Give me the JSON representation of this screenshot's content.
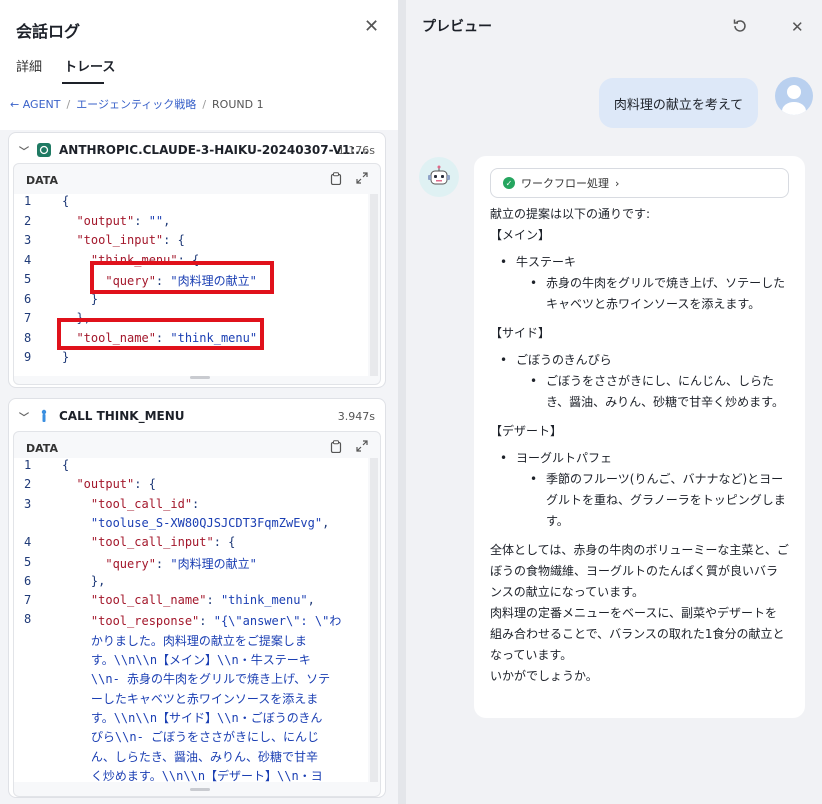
{
  "left_panel": {
    "title": "会話ログ",
    "close_icon": "close-icon",
    "tabs": [
      "詳細",
      "トレース"
    ],
    "active_tab": "トレース",
    "breadcrumb": [
      "← AGENT",
      "エージェンティック戦略",
      "ROUND 1"
    ],
    "card1": {
      "title": "ANTHROPIC.CLAUDE-3-HAIKU-20240307-V1:...",
      "duration": "1.176s",
      "data_label": "DATA",
      "icon": "model-icon",
      "lines": [
        {
          "n": "1",
          "parts": [
            {
              "t": "p",
              "v": "{"
            }
          ]
        },
        {
          "n": "2",
          "parts": [
            {
              "t": "k",
              "v": "  \"output\""
            },
            {
              "t": "p",
              "v": ": "
            },
            {
              "t": "s",
              "v": "\"\""
            },
            {
              "t": "p",
              "v": ","
            }
          ]
        },
        {
          "n": "3",
          "parts": [
            {
              "t": "k",
              "v": "  \"tool_input\""
            },
            {
              "t": "p",
              "v": ": {"
            }
          ]
        },
        {
          "n": "4",
          "parts": [
            {
              "t": "k",
              "v": "    \"think_menu\""
            },
            {
              "t": "p",
              "v": ": {"
            }
          ]
        },
        {
          "n": "5",
          "parts": [
            {
              "t": "k",
              "v": "      \"query\""
            },
            {
              "t": "p",
              "v": ": "
            },
            {
              "t": "s",
              "v": "\"肉料理の献立\""
            }
          ]
        },
        {
          "n": "6",
          "parts": [
            {
              "t": "p",
              "v": "    }"
            }
          ]
        },
        {
          "n": "7",
          "parts": [
            {
              "t": "p",
              "v": "  },"
            }
          ]
        },
        {
          "n": "8",
          "parts": [
            {
              "t": "k",
              "v": "  \"tool_name\""
            },
            {
              "t": "p",
              "v": ": "
            },
            {
              "t": "s",
              "v": "\"think_menu\""
            }
          ]
        },
        {
          "n": "9",
          "parts": [
            {
              "t": "p",
              "v": "}"
            }
          ]
        }
      ]
    },
    "card2": {
      "title": "CALL THINK_MENU",
      "duration": "3.947s",
      "data_label": "DATA",
      "icon": "tool-icon",
      "lines": [
        {
          "n": "1",
          "parts": [
            {
              "t": "p",
              "v": "{"
            }
          ]
        },
        {
          "n": "2",
          "parts": [
            {
              "t": "k",
              "v": "  \"output\""
            },
            {
              "t": "p",
              "v": ": {"
            }
          ]
        },
        {
          "n": "3",
          "parts": [
            {
              "t": "k",
              "v": "    \"tool_call_id\""
            },
            {
              "t": "p",
              "v": ":"
            }
          ]
        },
        {
          "n": "",
          "parts": [
            {
              "t": "s",
              "v": "    \"tooluse_S-XW80QJSJCDT3FqmZwEvg\""
            },
            {
              "t": "p",
              "v": ","
            }
          ]
        },
        {
          "n": "4",
          "parts": [
            {
              "t": "k",
              "v": "    \"tool_call_input\""
            },
            {
              "t": "p",
              "v": ": {"
            }
          ]
        },
        {
          "n": "5",
          "parts": [
            {
              "t": "k",
              "v": "      \"query\""
            },
            {
              "t": "p",
              "v": ": "
            },
            {
              "t": "s",
              "v": "\"肉料理の献立\""
            }
          ]
        },
        {
          "n": "6",
          "parts": [
            {
              "t": "p",
              "v": "    },"
            }
          ]
        },
        {
          "n": "7",
          "parts": [
            {
              "t": "k",
              "v": "    \"tool_call_name\""
            },
            {
              "t": "p",
              "v": ": "
            },
            {
              "t": "s",
              "v": "\"think_menu\""
            },
            {
              "t": "p",
              "v": ","
            }
          ]
        },
        {
          "n": "8",
          "parts": [
            {
              "t": "k",
              "v": "    \"tool_response\""
            },
            {
              "t": "p",
              "v": ": "
            },
            {
              "t": "s",
              "v": "\"{\\\"answer\\\": \\\"わ"
            }
          ]
        },
        {
          "n": "",
          "parts": [
            {
              "t": "s",
              "v": "    かりました。肉料理の献立をご提案しま"
            }
          ]
        },
        {
          "n": "",
          "parts": [
            {
              "t": "s",
              "v": "    す。\\\\n\\\\n【メイン】\\\\n・牛ステーキ"
            }
          ]
        },
        {
          "n": "",
          "parts": [
            {
              "t": "s",
              "v": "    \\\\n- 赤身の牛肉をグリルで焼き上げ、ソテ"
            }
          ]
        },
        {
          "n": "",
          "parts": [
            {
              "t": "s",
              "v": "    ーしたキャベツと赤ワインソースを添えま"
            }
          ]
        },
        {
          "n": "",
          "parts": [
            {
              "t": "s",
              "v": "    す。\\\\n\\\\n【サイド】\\\\n・ごぼうのきん"
            }
          ]
        },
        {
          "n": "",
          "parts": [
            {
              "t": "s",
              "v": "    ぴら\\\\n- ごぼうをささがきにし、にんじ"
            }
          ]
        },
        {
          "n": "",
          "parts": [
            {
              "t": "s",
              "v": "    ん、しらたき、醤油、みりん、砂糖で甘辛"
            }
          ]
        },
        {
          "n": "",
          "parts": [
            {
              "t": "s",
              "v": "    く炒めます。\\\\n\\\\n【デザート】\\\\n・ヨ"
            }
          ]
        }
      ]
    }
  },
  "right_panel": {
    "title": "プレビュー",
    "user_message": "肉料理の献立を考えて",
    "workflow_chip": "ワークフロー処理",
    "answer": {
      "intro": "献立の提案は以下の通りです:",
      "sections": [
        {
          "heading": "【メイン】",
          "item": "牛ステーキ",
          "detail": "赤身の牛肉をグリルで焼き上げ、ソテーしたキャベツと赤ワインソースを添えます。"
        },
        {
          "heading": "【サイド】",
          "item": "ごぼうのきんぴら",
          "detail": "ごぼうをささがきにし、にんじん、しらたき、醤油、みりん、砂糖で甘辛く炒めます。"
        },
        {
          "heading": "【デザート】",
          "item": "ヨーグルトパフェ",
          "detail": "季節のフルーツ(りんご、バナナなど)とヨーグルトを重ね、グラノーラをトッピングします。"
        }
      ],
      "summary": "全体としては、赤身の牛肉のボリューミーな主菜と、ごぼうの食物繊維、ヨーグルトのたんぱく質が良いバランスの献立になっています。",
      "note": "肉料理の定番メニューをベースに、副菜やデザートを組み合わせることで、バランスの取れた1食分の献立となっています。",
      "closing": "いかがでしょうか。"
    }
  },
  "colors": {
    "highlight_box": "#e0111b",
    "json_key": "#a3172b",
    "json_string": "#1b3fb3",
    "user_bubble": "#dde8f8"
  }
}
